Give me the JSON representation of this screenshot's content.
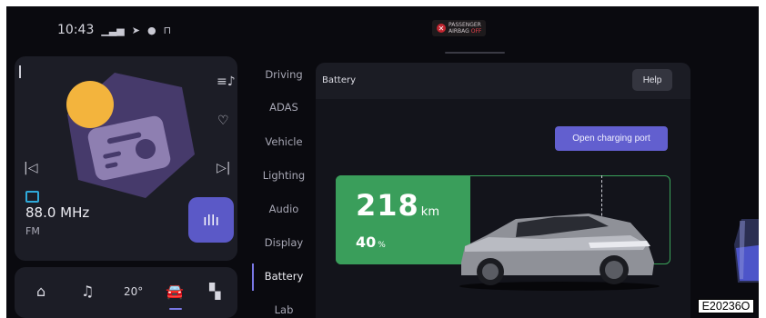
{
  "status": {
    "time": "10:43"
  },
  "airbag": {
    "line1": "PASSENGER",
    "line2": "AIRBAG",
    "state": "OFF"
  },
  "media": {
    "frequency": "88.0 MHz",
    "band": "FM",
    "icons": [
      "playlist-icon",
      "favorite-icon",
      "previous-icon",
      "next-icon",
      "radio-icon",
      "waveform-icon"
    ]
  },
  "dock": {
    "temperature": "20",
    "temperature_unit": "°",
    "icons": [
      "home-icon",
      "music-icon",
      "climate-icon",
      "car-icon",
      "apps-icon"
    ],
    "active": "car"
  },
  "nav": {
    "items": [
      "Driving",
      "ADAS",
      "Vehicle",
      "Lighting",
      "Audio",
      "Display",
      "Battery",
      "Lab"
    ],
    "active": "Battery"
  },
  "battery": {
    "title": "Battery",
    "help_label": "Help",
    "open_port_label": "Open charging port",
    "range_value": "218",
    "range_unit": "km",
    "percent_value": "40",
    "percent_unit": "%",
    "charge_fraction": 0.4,
    "charge_limit_fraction": 0.8,
    "fill_color": "#3a9e5b",
    "accent_color": "#625fcf"
  },
  "figure_code": "E20236O"
}
